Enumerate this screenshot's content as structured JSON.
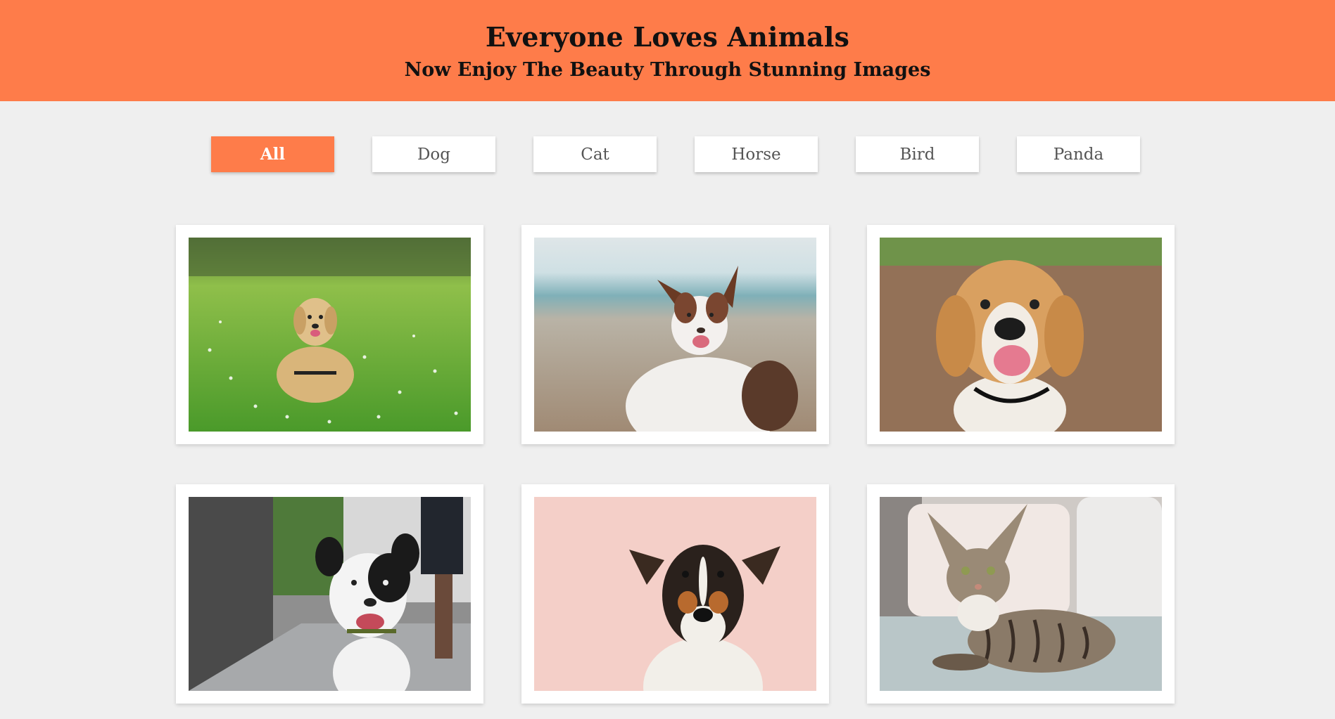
{
  "header": {
    "title": "Everyone Loves Animals",
    "subtitle": "Now Enjoy The Beauty Through Stunning Images",
    "background": "#fe7c4a"
  },
  "filters": [
    {
      "label": "All",
      "active": true
    },
    {
      "label": "Dog",
      "active": false
    },
    {
      "label": "Cat",
      "active": false
    },
    {
      "label": "Horse",
      "active": false
    },
    {
      "label": "Bird",
      "active": false
    },
    {
      "label": "Panda",
      "active": false
    }
  ],
  "gallery": {
    "items": [
      {
        "animal": "dog",
        "scene": "golden retriever lying in grass"
      },
      {
        "animal": "dog",
        "scene": "border collie at the beach"
      },
      {
        "animal": "dog",
        "scene": "beagle close-up"
      },
      {
        "animal": "dog",
        "scene": "black and white dog on sidewalk"
      },
      {
        "animal": "dog",
        "scene": "terrier on pink background"
      },
      {
        "animal": "cat",
        "scene": "tabby cat on couch"
      }
    ]
  },
  "colors": {
    "accent": "#fe7c4a",
    "page_background": "#efefef",
    "button_background": "#ffffff",
    "button_text": "#555555"
  }
}
